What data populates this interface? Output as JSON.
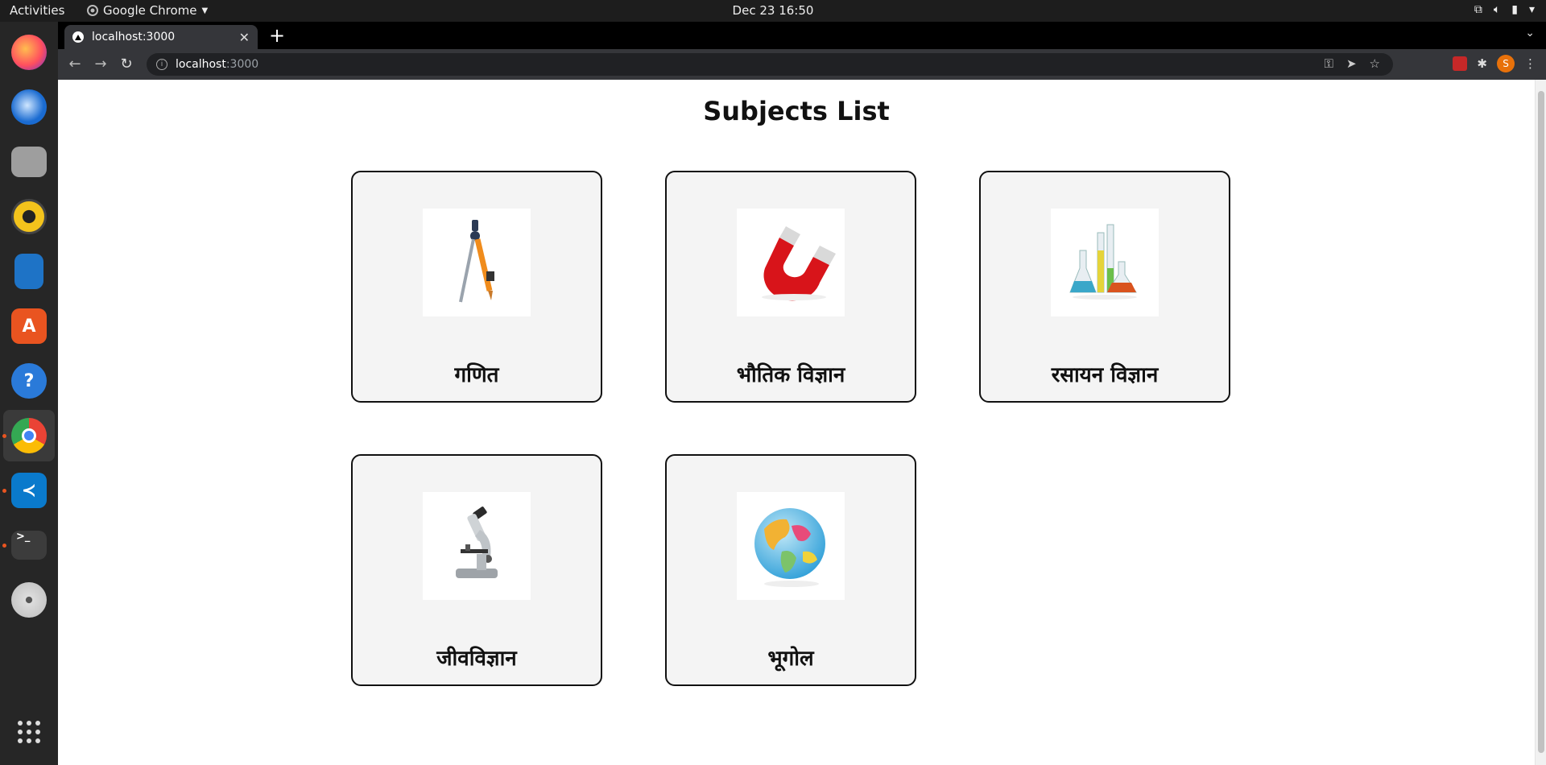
{
  "system": {
    "activities": "Activities",
    "app_name": "Google Chrome",
    "clock": "Dec 23  16:50"
  },
  "browser": {
    "tab_title": "localhost:3000",
    "url_host": "localhost",
    "url_port": ":3000",
    "profile_initial": "S"
  },
  "page": {
    "title": "Subjects List",
    "subjects": [
      {
        "label": "गणित",
        "icon": "compass-icon"
      },
      {
        "label": "भौतिक विज्ञान",
        "icon": "magnet-icon"
      },
      {
        "label": "रसायन विज्ञान",
        "icon": "lab-flasks-icon"
      },
      {
        "label": "जीवविज्ञान",
        "icon": "microscope-icon"
      },
      {
        "label": "भूगोल",
        "icon": "globe-icon"
      }
    ]
  }
}
